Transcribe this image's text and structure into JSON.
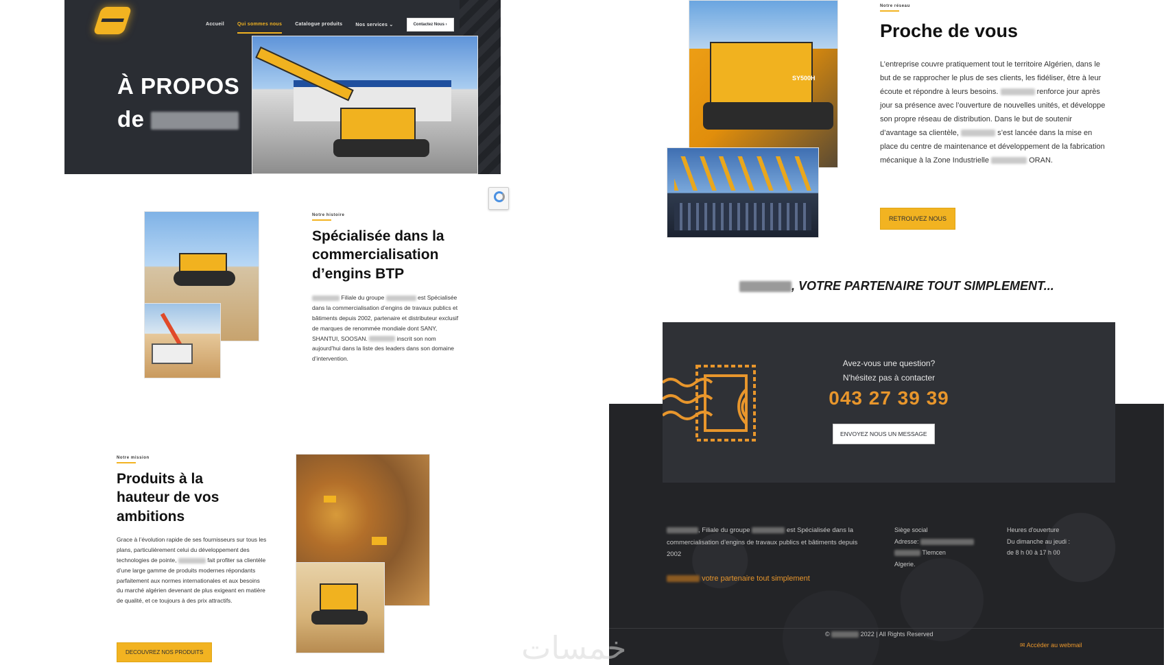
{
  "nav": {
    "items": [
      "Accueil",
      "Qui sommes nous",
      "Catalogue produits",
      "Nos services"
    ],
    "services_chevron": "⌄",
    "contact_label": "Contactez Nous ›"
  },
  "hero": {
    "title_line1": "À PROPOS",
    "title_line2": "de"
  },
  "history": {
    "eyebrow": "Notre histoire",
    "title": "Spécialisée dans la commercialisation d’engins BTP",
    "p1": "Filiale du groupe",
    "p2": "est",
    "p3": "Spécialisée dans la commercialisation d’engins de travaux publics et bâtiments depuis 2002, partenaire et distributeur exclusif de marques de renommée mondiale dont SANY, SHANTUI, SOOSAN.",
    "p4": "inscrit son nom aujourd’hui dans la liste des leaders dans son domaine d’intervention."
  },
  "mission": {
    "eyebrow": "Notre mission",
    "title": "Produits à la hauteur de vos ambitions",
    "p1": "Grace à l’évolution rapide de ses fournisseurs sur tous les plans, particulièrement celui du développement des technologies de pointe,",
    "p2": "fait profiter sa clientèle d’une large gamme de produits modernes répondants parfaitement aux normes internationales et aux besoins du marché algérien devenant de plus exigeant en matière de qualité, et ce toujours à des prix attractifs.",
    "button": "DECOUVREZ NOS PRODUITS"
  },
  "network": {
    "eyebrow": "Notre réseau",
    "title": "Proche de vous",
    "p1": "L’entreprise couvre pratiquement tout le territoire Algérien, dans le but de se rapprocher le plus de ses clients, les fidéliser, être à leur écoute et répondre à leurs besoins.",
    "p2": "renforce jour après jour sa présence avec l’ouverture de nouvelles unités, et développe son propre réseau de distribution. Dans le but de soutenir d’avantage sa clientèle,",
    "p3": "s’est lancée dans la mise en place du centre de maintenance et développement de la fabrication mécanique à la Zone Industrielle",
    "p4": "ORAN.",
    "button": "RETROUVEZ NOUS",
    "machine_label": "SY500H"
  },
  "partner": {
    "tagline": ", VOTRE PARTENAIRE TOUT SIMPLEMENT..."
  },
  "contact": {
    "question": "Avez-vous une question?",
    "subtitle": "N'hésitez pas à contacter",
    "phone": "043 27 39 39",
    "button": "ENVOYEZ NOUS UN MESSAGE"
  },
  "footer": {
    "about_1": ", Filiale du groupe",
    "about_2": "est Spécialisée dans la commercialisation d’engins de travaux publics et bâtiments depuis 2002",
    "slogan": "votre partenaire tout simplement",
    "hq_title": "Siège social",
    "address_label": "Adresse:",
    "city": "Tlemcen",
    "country": "Algerie.",
    "hours_title": "Heures d'ouverture",
    "hours_days": "Du dimanche au jeudi :",
    "hours_time": "de 8 h 00 à 17 h 00",
    "copyright_symbol": "©",
    "copyright_text": "2022 | All Rights Reserved",
    "webmail": "Accéder au webmail"
  },
  "watermark": "خمسات",
  "colors": {
    "accent": "#f2b321",
    "orange": "#e8962c",
    "dark": "#2a2d33",
    "footer": "#232427"
  }
}
